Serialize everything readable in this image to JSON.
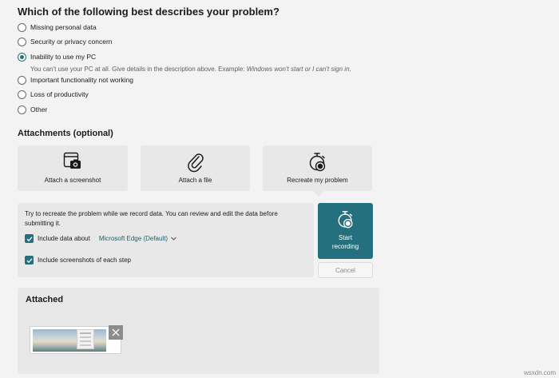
{
  "question": "Which of the following best describes your problem?",
  "options": [
    {
      "label": "Missing personal data",
      "checked": false
    },
    {
      "label": "Security or privacy concern",
      "checked": false
    },
    {
      "label": "Inability to use my PC",
      "checked": true
    },
    {
      "label": "Important functionality not working",
      "checked": false
    },
    {
      "label": "Loss of productivity",
      "checked": false
    },
    {
      "label": "Other",
      "checked": false
    }
  ],
  "option_help": {
    "text": "You can't use your PC at all. Give details in the description above. Example: ",
    "example": "Windows won't start or I can't sign in."
  },
  "attachments": {
    "title": "Attachments (optional)",
    "screenshot_label": "Attach a screenshot",
    "file_label": "Attach a file",
    "recreate_label": "Recreate my problem"
  },
  "recording": {
    "description": "Try to recreate the problem while we record data. You can review and edit the data before submitting it.",
    "include_data_label": "Include data about",
    "browser": "Microsoft Edge (Default)",
    "include_screenshots_label": "Include screenshots of each step",
    "start_label": "Start recording",
    "cancel_label": "Cancel"
  },
  "attached": {
    "title": "Attached"
  },
  "watermark": "wsxdn.com",
  "colors": {
    "accent": "#24707e",
    "panel": "#e8e8e8",
    "background": "#f3f3f3"
  }
}
